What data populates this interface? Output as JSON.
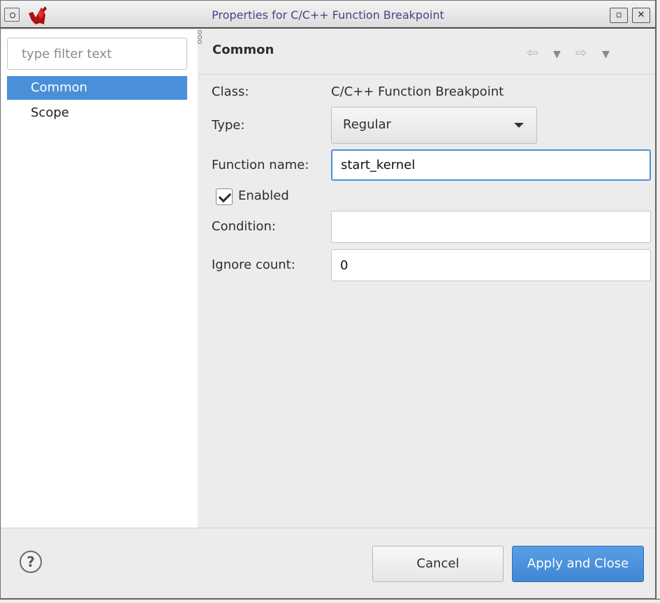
{
  "window": {
    "title": "Properties for C/C++ Function Breakpoint"
  },
  "sidebar": {
    "filter_placeholder": "type filter text",
    "items": [
      {
        "label": "Common",
        "selected": true
      },
      {
        "label": "Scope",
        "selected": false
      }
    ]
  },
  "page": {
    "title": "Common",
    "class_label": "Class:",
    "class_value": "C/C++ Function Breakpoint",
    "type_label": "Type:",
    "type_value": "Regular",
    "function_name_label": "Function name:",
    "function_name_value": "start_kernel",
    "enabled_label": "Enabled",
    "enabled_checked": true,
    "condition_label": "Condition:",
    "condition_value": "",
    "ignore_count_label": "Ignore count:",
    "ignore_count_value": "0"
  },
  "footer": {
    "help_label": "?",
    "cancel_label": "Cancel",
    "apply_label": "Apply and Close"
  },
  "colors": {
    "accent": "#4a90d9",
    "title_text": "#4a4088"
  }
}
